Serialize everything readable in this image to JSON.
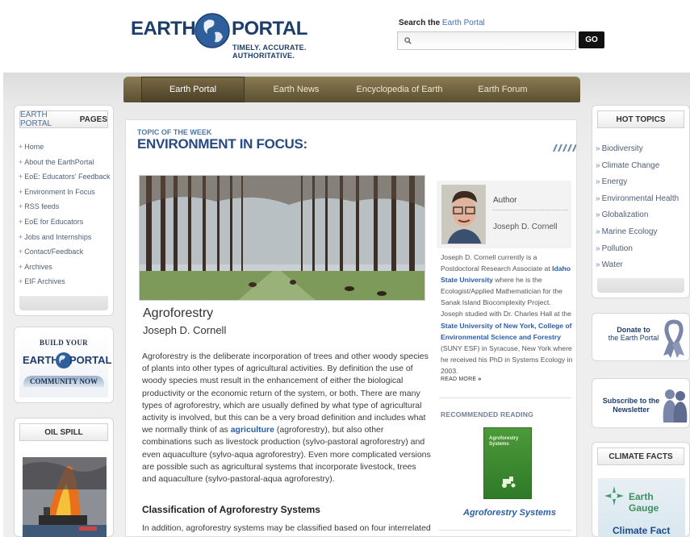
{
  "header": {
    "logo": {
      "left": "EARTH",
      "right": "PORTAL",
      "tagline": "TIMELY. ACCURATE. AUTHORITATIVE."
    },
    "search": {
      "label_prefix": "Search the",
      "label_accent": "Earth Portal",
      "placeholder": "",
      "value": "",
      "go_label": "GO"
    }
  },
  "nav": {
    "tabs": [
      {
        "label": "Earth Portal",
        "active": true
      },
      {
        "label": "Earth News",
        "active": false
      },
      {
        "label": "Encyclopedia of Earth",
        "active": false
      },
      {
        "label": "Earth Forum",
        "active": false
      }
    ]
  },
  "left_sidebar": {
    "pages_title_a": "EARTH PORTAL",
    "pages_title_b": "PAGES",
    "links": [
      "Home",
      "About the EarthPortal",
      "EoE: Educators' Feedback",
      "Environment In Focus",
      "RSS feeds",
      "EoE for Educators",
      "Jobs and Internships",
      "Contact/Feedback",
      "Archives",
      "EIF Archives"
    ],
    "community": {
      "line1": "BUILD YOUR",
      "earth": "EARTH",
      "portal": "PORTAL",
      "line3": "COMMUNITY NOW"
    },
    "oil_spill_title": "OIL SPILL"
  },
  "main": {
    "topic_small": "TOPIC OF THE WEEK",
    "topic_title": "ENVIRONMENT IN FOCUS:",
    "article": {
      "title": "Agroforestry",
      "author": "Joseph D. Cornell",
      "body_before_link": "Agroforestry is the deliberate incorporation of trees and other woody species of plants into other types of agricultural activities. By definition the use of woody species must result in the enhancement of either the biological productivity or the economic return of the system, or both. There are many types of agroforestry, which are usually defined by what type of agricultural activity is involved, but this can be a very broad definition and includes what we normally think of as",
      "body_link": "agriculture",
      "body_after_link": "(agroforestry), but also other combinations such as livestock production (sylvo-pastoral agroforestry) and even aquaculture (sylvo-aqua agroforestry). Even more complicated versions are possible such as agricultural systems that incorporate livestock, trees and aquaculture (sylvo-pastoral-aqua agroforestry).",
      "section_heading": "Classification of Agroforestry Systems",
      "section_text": "In addition, agroforestry systems may be classified based on four interrelated"
    },
    "author_box": {
      "label": "Author",
      "name": "Joseph D. Cornell",
      "bio_1": "Joseph D. Cornell currently is a Postdoctoral Research Associate at",
      "bio_link_1": "Idaho State University",
      "bio_2": "where he is the Ecologist/Applied Mathematician for the Sanak Island Biocomplexity Project. Joseph studied with Dr. Charles Hall at the",
      "bio_link_2": "State University of New York, College of Environmental Science and Forestry",
      "bio_3": "(SUNY ESF) in Syracuse, New York where he received his PhD in Systems Ecology in 2003.",
      "read_more": "READ MORE"
    },
    "recommended": {
      "heading": "RECOMMENDED READING",
      "book_cover_title": "Agroforestry Systems",
      "book_title": "Agroforestry Systems"
    }
  },
  "right_sidebar": {
    "hot_topics_title": "HOT TOPICS",
    "topics": [
      "Biodiversity",
      "Climate Change",
      "Energy",
      "Environmental Health",
      "Globalization",
      "Marine Ecology",
      "Pollution",
      "Water"
    ],
    "donate_line1": "Donate to",
    "donate_line2": "the Earth Portal",
    "newsletter_line1": "Subscribe to the",
    "newsletter_line2": "Newsletter",
    "climate_title": "CLIMATE FACTS",
    "earth_gauge": "Earth Gauge",
    "climate_fact": "Climate Fact"
  },
  "colors": {
    "nav_brown": "#6b5d3c",
    "link_blue": "#2a5ea8",
    "brand_navy": "#1d3d6b"
  }
}
